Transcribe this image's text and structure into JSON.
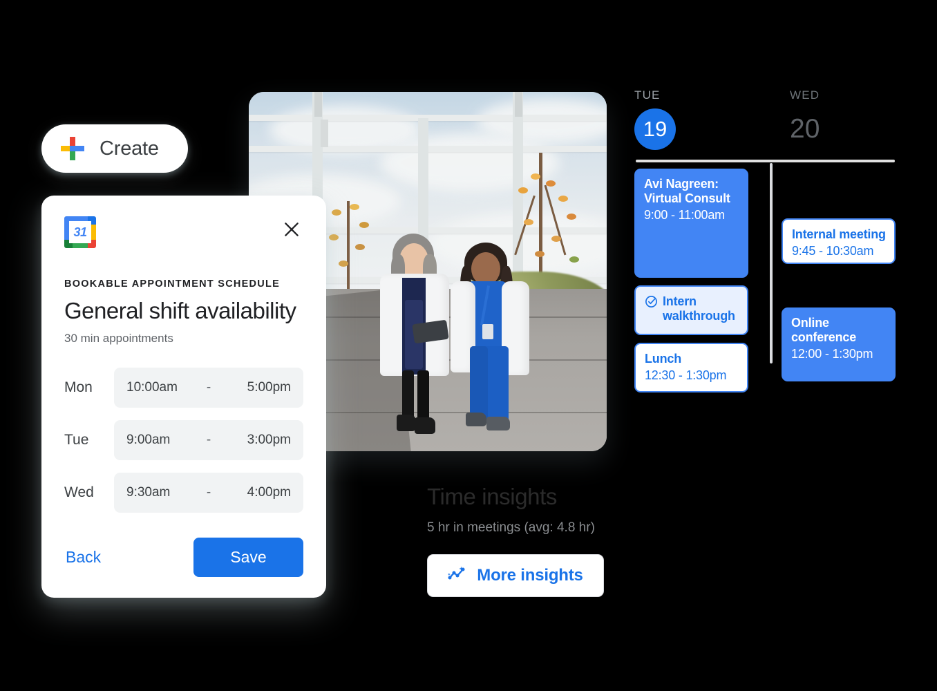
{
  "colors": {
    "accent_blue": "#1a73e8",
    "event_blue": "#4285F4",
    "event_tint": "#e8f0fe",
    "background": "#000000",
    "field_grey": "#f1f3f4",
    "muted_text": "#5f6368"
  },
  "create_button": {
    "label": "Create",
    "icon": "google-plus-icon"
  },
  "dialog": {
    "app_icon": "google-calendar-icon",
    "app_icon_day": "31",
    "close_icon": "close-icon",
    "eyebrow": "BOOKABLE APPOINTMENT SCHEDULE",
    "title": "General shift availability",
    "subtitle": "30 min appointments",
    "schedule": [
      {
        "day": "Mon",
        "start": "10:00am",
        "dash": "-",
        "end": "5:00pm"
      },
      {
        "day": "Tue",
        "start": "9:00am",
        "dash": "-",
        "end": "3:00pm"
      },
      {
        "day": "Wed",
        "start": "9:30am",
        "dash": "-",
        "end": "4:00pm"
      }
    ],
    "back_label": "Back",
    "save_label": "Save"
  },
  "photo": {
    "alt": "Two healthcare workers in white lab coats walking outdoors and looking at a tablet"
  },
  "time_insights": {
    "title": "Time insights",
    "summary": "5 hr in meetings (avg: 4.8 hr)",
    "button_label": "More insights",
    "button_icon": "insights-chart-icon"
  },
  "calendar": {
    "days": [
      {
        "dow": "TUE",
        "num": "19",
        "selected": true
      },
      {
        "dow": "WED",
        "num": "20",
        "selected": false
      }
    ],
    "columns": [
      {
        "day": "TUE",
        "events": [
          {
            "title": "Avi Nagreen: Virtual Consult",
            "time": "9:00 - 11:00am",
            "style": "filled",
            "icon": null
          },
          {
            "title": "Intern walkthrough",
            "time": "",
            "style": "tinted",
            "icon": "check-circle-icon"
          },
          {
            "title": "Lunch",
            "time": "12:30 - 1:30pm",
            "style": "outline",
            "icon": null
          }
        ]
      },
      {
        "day": "WED",
        "events": [
          {
            "title": "Internal meeting",
            "time": "9:45 - 10:30am",
            "style": "outline",
            "icon": null
          },
          {
            "title": "Online conference",
            "time": "12:00 - 1:30pm",
            "style": "filled",
            "icon": null
          }
        ]
      }
    ]
  }
}
